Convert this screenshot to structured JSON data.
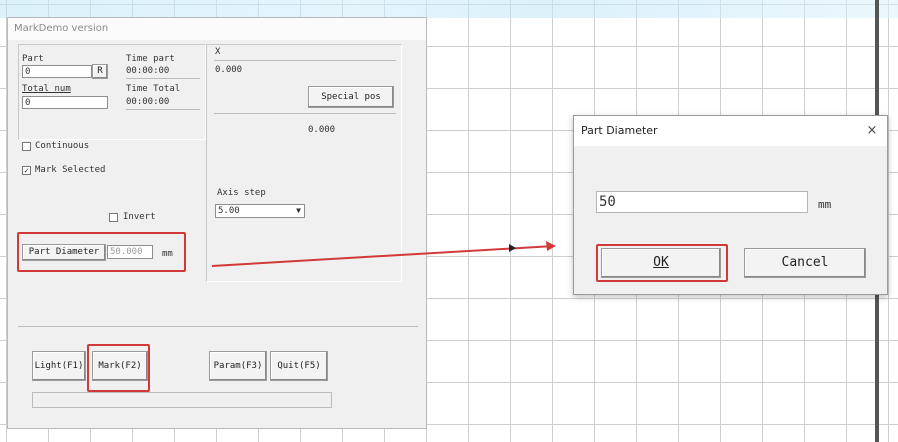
{
  "main_window": {
    "title": "MarkDemo version",
    "part_label": "Part",
    "part_value": "0",
    "r_button": "R",
    "time_part_label": "Time part",
    "time_part_value": "00:00:00",
    "total_num_label": "Total num",
    "total_num_value": "0",
    "time_total_label": "Time Total",
    "time_total_value": "00:00:00",
    "continuous_label": "Continuous",
    "continuous_checked": false,
    "mark_selected_label": "Mark Selected",
    "mark_selected_checked": true,
    "invert_label": "Invert",
    "invert_checked": false,
    "part_diameter_button": "Part Diameter",
    "part_diameter_value": "50.000",
    "part_diameter_unit": "mm",
    "x_label": "X",
    "x_value": "0.000",
    "special_pos_button": "Special pos",
    "special_pos_value": "0.000",
    "axis_step_label": "Axis step",
    "axis_step_value": "5.00",
    "buttons": {
      "light": "Light(F1)",
      "mark": "Mark(F2)",
      "param": "Param(F3)",
      "quit": "Quit(F5)"
    }
  },
  "dialog": {
    "title": "Part Diameter",
    "close_symbol": "×",
    "input_value": "50",
    "unit": "mm",
    "ok_label": "OK",
    "cancel_label": "Cancel"
  },
  "colors": {
    "highlight": "#d23a3a",
    "window_bg": "#f0f0f0"
  }
}
